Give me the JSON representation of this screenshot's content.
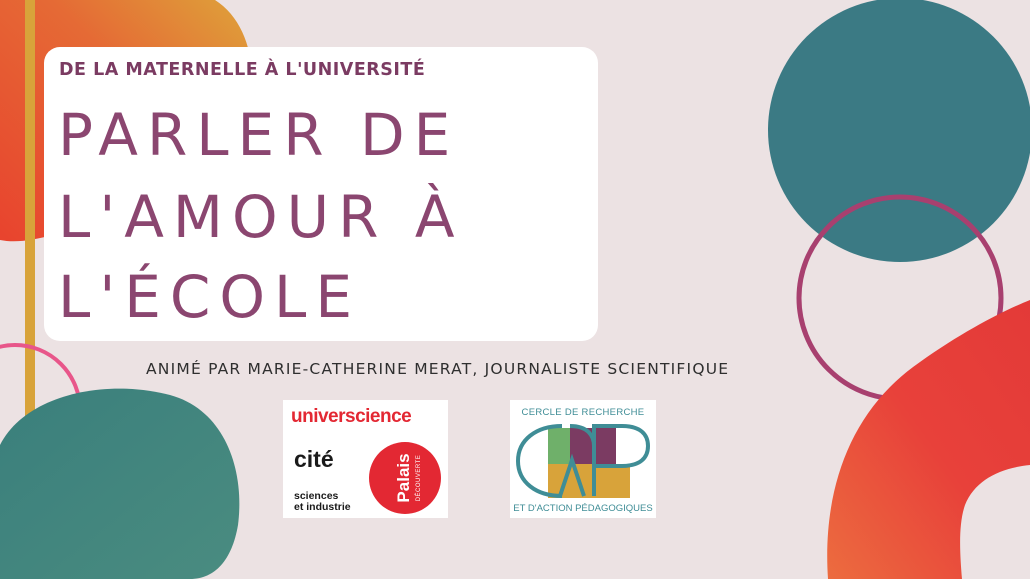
{
  "header": {
    "kicker": "DE LA MATERNELLE À L'UNIVERSITÉ",
    "title_lines": [
      "PARLER DE",
      "L'AMOUR À",
      "L'ÉCOLE"
    ]
  },
  "host_line": "ANIMÉ PAR MARIE-CATHERINE MERAT, JOURNALISTE SCIENTIFIQUE",
  "logos": {
    "universcience": {
      "brand": "universcience",
      "cite": "cité",
      "sciences_line1": "sciences",
      "sciences_line2": "et industrie",
      "palais": "Palais",
      "decouverte": "DÉCOUVERTE"
    },
    "crap": {
      "top_text": "CERCLE DE RECHERCHE",
      "bottom_text": "ET D'ACTION PÉDAGOGIQUES"
    }
  },
  "colors": {
    "background": "#ece2e3",
    "title": "#8b4670",
    "teal": "#3b7a84",
    "orange": "#e85a34",
    "magenta": "#a8406f",
    "mustard": "#d8a33a",
    "brand_red": "#e32833"
  }
}
